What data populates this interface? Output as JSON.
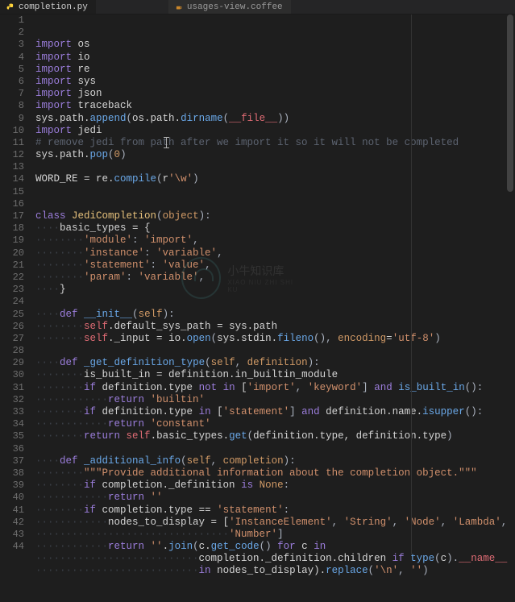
{
  "tabs": {
    "active": {
      "label": "completion.py",
      "icon": "python-icon"
    },
    "inactive": {
      "label": "usages-view.coffee",
      "icon": "coffee-icon"
    }
  },
  "watermark": {
    "main": "小牛知识库",
    "sub": "XIAO NIU ZHI SHI KU"
  },
  "gutter": {
    "start": 1,
    "end": 44
  },
  "code_lines": [
    [
      [
        "kw-import",
        "import"
      ],
      [
        "text",
        " "
      ],
      [
        "text",
        "os"
      ]
    ],
    [
      [
        "kw-import",
        "import"
      ],
      [
        "text",
        " "
      ],
      [
        "text",
        "io"
      ]
    ],
    [
      [
        "kw-import",
        "import"
      ],
      [
        "text",
        " "
      ],
      [
        "text",
        "re"
      ]
    ],
    [
      [
        "kw-import",
        "import"
      ],
      [
        "text",
        " "
      ],
      [
        "text",
        "sys"
      ]
    ],
    [
      [
        "kw-import",
        "import"
      ],
      [
        "text",
        " "
      ],
      [
        "text",
        "json"
      ]
    ],
    [
      [
        "kw-import",
        "import"
      ],
      [
        "text",
        " "
      ],
      [
        "text",
        "traceback"
      ]
    ],
    [
      [
        "text",
        "sys.path."
      ],
      [
        "fn",
        "append"
      ],
      [
        "punc",
        "("
      ],
      [
        "text",
        "os.path."
      ],
      [
        "fn",
        "dirname"
      ],
      [
        "punc",
        "("
      ],
      [
        "self",
        "__file__"
      ],
      [
        "punc",
        "))"
      ]
    ],
    [
      [
        "kw-import",
        "import"
      ],
      [
        "text",
        " "
      ],
      [
        "text",
        "jedi"
      ]
    ],
    [
      [
        "cmt",
        "# remove jedi from path after we import it so it will not be completed"
      ]
    ],
    [
      [
        "text",
        "sys.path."
      ],
      [
        "fn",
        "pop"
      ],
      [
        "punc",
        "("
      ],
      [
        "num",
        "0"
      ],
      [
        "punc",
        ")"
      ]
    ],
    [],
    [
      [
        "text",
        "WORD_RE "
      ],
      [
        "op",
        "="
      ],
      [
        "text",
        " re."
      ],
      [
        "fn",
        "compile"
      ],
      [
        "punc",
        "("
      ],
      [
        "text",
        "r"
      ],
      [
        "str",
        "'\\w'"
      ],
      [
        "punc",
        ")"
      ]
    ],
    [],
    [],
    [
      [
        "kw",
        "class"
      ],
      [
        "text",
        " "
      ],
      [
        "cls",
        "JediCompletion"
      ],
      [
        "punc",
        "("
      ],
      [
        "param",
        "object"
      ],
      [
        "punc",
        "):"
      ]
    ],
    [
      [
        "dots",
        "····"
      ],
      [
        "text",
        "basic_types "
      ],
      [
        "op",
        "="
      ],
      [
        "text",
        " {"
      ]
    ],
    [
      [
        "dots",
        "········"
      ],
      [
        "str",
        "'module'"
      ],
      [
        "punc",
        ": "
      ],
      [
        "str",
        "'import'"
      ],
      [
        "punc",
        ","
      ]
    ],
    [
      [
        "dots",
        "········"
      ],
      [
        "str",
        "'instance'"
      ],
      [
        "punc",
        ": "
      ],
      [
        "str",
        "'variable'"
      ],
      [
        "punc",
        ","
      ]
    ],
    [
      [
        "dots",
        "········"
      ],
      [
        "str",
        "'statement'"
      ],
      [
        "punc",
        ": "
      ],
      [
        "str",
        "'value'"
      ],
      [
        "punc",
        ","
      ]
    ],
    [
      [
        "dots",
        "········"
      ],
      [
        "str",
        "'param'"
      ],
      [
        "punc",
        ": "
      ],
      [
        "str",
        "'variable'"
      ],
      [
        "punc",
        ","
      ]
    ],
    [
      [
        "dots",
        "····"
      ],
      [
        "text",
        "}"
      ]
    ],
    [],
    [
      [
        "dots",
        "····"
      ],
      [
        "kw",
        "def"
      ],
      [
        "text",
        " "
      ],
      [
        "fn",
        "__init__"
      ],
      [
        "punc",
        "("
      ],
      [
        "param",
        "self"
      ],
      [
        "punc",
        "):"
      ]
    ],
    [
      [
        "dots",
        "········"
      ],
      [
        "self",
        "self"
      ],
      [
        "text",
        ".default_sys_path "
      ],
      [
        "op",
        "="
      ],
      [
        "text",
        " sys.path"
      ]
    ],
    [
      [
        "dots",
        "········"
      ],
      [
        "self",
        "self"
      ],
      [
        "text",
        "._input "
      ],
      [
        "op",
        "="
      ],
      [
        "text",
        " io."
      ],
      [
        "fn",
        "open"
      ],
      [
        "punc",
        "("
      ],
      [
        "text",
        "sys.stdin."
      ],
      [
        "fn",
        "fileno"
      ],
      [
        "punc",
        "(), "
      ],
      [
        "param",
        "encoding"
      ],
      [
        "op",
        "="
      ],
      [
        "str",
        "'utf-8'"
      ],
      [
        "punc",
        ")"
      ]
    ],
    [],
    [
      [
        "dots",
        "····"
      ],
      [
        "kw",
        "def"
      ],
      [
        "text",
        " "
      ],
      [
        "fn",
        "_get_definition_type"
      ],
      [
        "punc",
        "("
      ],
      [
        "param",
        "self"
      ],
      [
        "punc",
        ", "
      ],
      [
        "param",
        "definition"
      ],
      [
        "punc",
        "):"
      ]
    ],
    [
      [
        "dots",
        "········"
      ],
      [
        "text",
        "is_built_in "
      ],
      [
        "op",
        "="
      ],
      [
        "text",
        " definition.in_builtin_module"
      ]
    ],
    [
      [
        "dots",
        "········"
      ],
      [
        "kw",
        "if"
      ],
      [
        "text",
        " definition.type "
      ],
      [
        "kw",
        "not"
      ],
      [
        "text",
        " "
      ],
      [
        "kw",
        "in"
      ],
      [
        "text",
        " ["
      ],
      [
        "str",
        "'import'"
      ],
      [
        "punc",
        ", "
      ],
      [
        "str",
        "'keyword'"
      ],
      [
        "punc",
        "] "
      ],
      [
        "kw",
        "and"
      ],
      [
        "text",
        " "
      ],
      [
        "fn",
        "is_built_in"
      ],
      [
        "punc",
        "():"
      ]
    ],
    [
      [
        "dots",
        "············"
      ],
      [
        "kw",
        "return"
      ],
      [
        "text",
        " "
      ],
      [
        "str",
        "'builtin'"
      ]
    ],
    [
      [
        "dots",
        "········"
      ],
      [
        "kw",
        "if"
      ],
      [
        "text",
        " definition.type "
      ],
      [
        "kw",
        "in"
      ],
      [
        "text",
        " ["
      ],
      [
        "str",
        "'statement'"
      ],
      [
        "punc",
        "] "
      ],
      [
        "kw",
        "and"
      ],
      [
        "text",
        " definition.name."
      ],
      [
        "fn",
        "isupper"
      ],
      [
        "punc",
        "():"
      ]
    ],
    [
      [
        "dots",
        "············"
      ],
      [
        "kw",
        "return"
      ],
      [
        "text",
        " "
      ],
      [
        "str",
        "'constant'"
      ]
    ],
    [
      [
        "dots",
        "········"
      ],
      [
        "kw",
        "return"
      ],
      [
        "text",
        " "
      ],
      [
        "self",
        "self"
      ],
      [
        "text",
        ".basic_types."
      ],
      [
        "fn",
        "get"
      ],
      [
        "punc",
        "("
      ],
      [
        "text",
        "definition.type, definition.type"
      ],
      [
        "punc",
        ")"
      ]
    ],
    [],
    [
      [
        "dots",
        "····"
      ],
      [
        "kw",
        "def"
      ],
      [
        "text",
        " "
      ],
      [
        "fn",
        "_additional_info"
      ],
      [
        "punc",
        "("
      ],
      [
        "param",
        "self"
      ],
      [
        "punc",
        ", "
      ],
      [
        "param",
        "completion"
      ],
      [
        "punc",
        "):"
      ]
    ],
    [
      [
        "dots",
        "········"
      ],
      [
        "str",
        "\"\"\"Provide additional information about the completion object.\"\"\""
      ]
    ],
    [
      [
        "dots",
        "········"
      ],
      [
        "kw",
        "if"
      ],
      [
        "text",
        " completion._definition "
      ],
      [
        "kw",
        "is"
      ],
      [
        "text",
        " "
      ],
      [
        "param",
        "None"
      ],
      [
        "punc",
        ":"
      ]
    ],
    [
      [
        "dots",
        "············"
      ],
      [
        "kw",
        "return"
      ],
      [
        "text",
        " "
      ],
      [
        "str",
        "''"
      ]
    ],
    [
      [
        "dots",
        "········"
      ],
      [
        "kw",
        "if"
      ],
      [
        "text",
        " completion.type "
      ],
      [
        "op",
        "=="
      ],
      [
        "text",
        " "
      ],
      [
        "str",
        "'statement'"
      ],
      [
        "punc",
        ":"
      ]
    ],
    [
      [
        "dots",
        "············"
      ],
      [
        "text",
        "nodes_to_display "
      ],
      [
        "op",
        "="
      ],
      [
        "text",
        " ["
      ],
      [
        "str",
        "'InstanceElement'"
      ],
      [
        "punc",
        ", "
      ],
      [
        "str",
        "'String'"
      ],
      [
        "punc",
        ", "
      ],
      [
        "str",
        "'Node'"
      ],
      [
        "punc",
        ", "
      ],
      [
        "str",
        "'Lambda'"
      ],
      [
        "punc",
        ","
      ]
    ],
    [
      [
        "dots",
        "································"
      ],
      [
        "str",
        "'Number'"
      ],
      [
        "punc",
        "]"
      ]
    ],
    [
      [
        "dots",
        "············"
      ],
      [
        "kw",
        "return"
      ],
      [
        "text",
        " "
      ],
      [
        "str",
        "''"
      ],
      [
        "text",
        "."
      ],
      [
        "fn",
        "join"
      ],
      [
        "punc",
        "("
      ],
      [
        "text",
        "c."
      ],
      [
        "fn",
        "get_code"
      ],
      [
        "punc",
        "() "
      ],
      [
        "kw",
        "for"
      ],
      [
        "text",
        " c "
      ],
      [
        "kw",
        "in"
      ]
    ],
    [
      [
        "dots",
        "···························"
      ],
      [
        "text",
        "completion._definition.children "
      ],
      [
        "kw",
        "if"
      ],
      [
        "text",
        " "
      ],
      [
        "fn",
        "type"
      ],
      [
        "punc",
        "("
      ],
      [
        "text",
        "c"
      ],
      [
        "punc",
        ")."
      ],
      [
        "self",
        "__name__"
      ]
    ],
    [
      [
        "dots",
        "···························"
      ],
      [
        "kw",
        "in"
      ],
      [
        "text",
        " nodes_to_display)."
      ],
      [
        "fn",
        "replace"
      ],
      [
        "punc",
        "("
      ],
      [
        "str",
        "'\\n'"
      ],
      [
        "punc",
        ", "
      ],
      [
        "str",
        "''"
      ],
      [
        "punc",
        ")"
      ]
    ]
  ]
}
